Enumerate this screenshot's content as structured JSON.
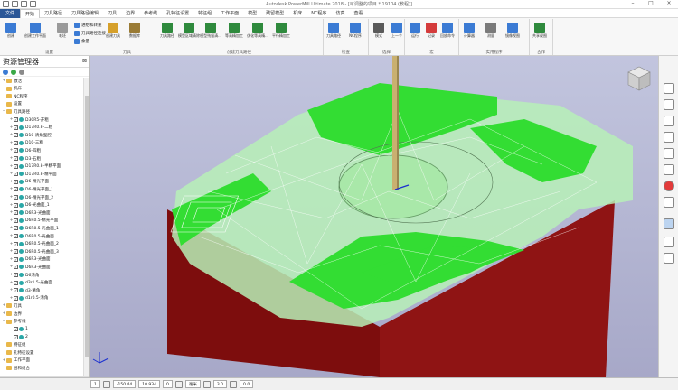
{
  "window": {
    "title": "Autodesk PowerMill Ultimate 2018 - [可调整的项目 * 19104 (教程)]"
  },
  "tabs": [
    {
      "label": "文件",
      "active": false,
      "file": true
    },
    {
      "label": "开始",
      "active": true
    },
    {
      "label": "刀具路径",
      "active": false
    },
    {
      "label": "刀具路径编辑",
      "active": false
    },
    {
      "label": "刀具",
      "active": false
    },
    {
      "label": "边界",
      "active": false
    },
    {
      "label": "参考线",
      "active": false
    },
    {
      "label": "孔特征设置",
      "active": false
    },
    {
      "label": "特征组",
      "active": false
    },
    {
      "label": "工作平面",
      "active": false
    },
    {
      "label": "模型",
      "active": false
    },
    {
      "label": "残留模型",
      "active": false
    },
    {
      "label": "机床",
      "active": false
    },
    {
      "label": "NC程序",
      "active": false
    },
    {
      "label": "仿真",
      "active": false
    },
    {
      "label": "查看",
      "active": false
    }
  ],
  "ribbon": {
    "groups": [
      {
        "label": "设置"
      },
      {
        "label": "刀具"
      },
      {
        "label": "创建刀具路径"
      },
      {
        "label": "检查"
      },
      {
        "label": "选择"
      },
      {
        "label": "宏"
      },
      {
        "label": "实用程序"
      },
      {
        "label": "合作"
      }
    ],
    "large_buttons": [
      {
        "label": "创建"
      },
      {
        "label": "创建工作平面"
      },
      {
        "label": "毛坯"
      },
      {
        "label": "创建刀具"
      },
      {
        "label": "数据库"
      },
      {
        "label": "刀具路径"
      },
      {
        "label": "模型区域清除"
      },
      {
        "label": "模型残留清..."
      },
      {
        "label": "等高精加工"
      },
      {
        "label": "优化等高精..."
      },
      {
        "label": "平行精加工"
      },
      {
        "label": "刀具路径"
      },
      {
        "label": "NC程序"
      },
      {
        "label": "模式"
      },
      {
        "label": "上一个"
      },
      {
        "label": "运行"
      },
      {
        "label": "记录"
      },
      {
        "label": "回放命令"
      },
      {
        "label": "计算器"
      },
      {
        "label": "测量"
      },
      {
        "label": "镜像视图"
      },
      {
        "label": "共享视图"
      }
    ],
    "small_buttons": [
      {
        "label": "进给和转速"
      },
      {
        "label": "刀具路径连接"
      },
      {
        "label": "余量"
      }
    ]
  },
  "explorer": {
    "title": "资源管理器",
    "tree": [
      {
        "label": "激活",
        "level": 0,
        "exp": "+"
      },
      {
        "label": "机床",
        "level": 0,
        "exp": ""
      },
      {
        "label": "NC程序",
        "level": 0,
        "exp": ""
      },
      {
        "label": "设置",
        "level": 0,
        "exp": ""
      },
      {
        "label": "刀具路径",
        "level": 0,
        "exp": "−"
      },
      {
        "label": "D30R5-开粗",
        "level": 1,
        "exp": "+"
      },
      {
        "label": "D17R0.8-二粗",
        "level": 1,
        "exp": "+"
      },
      {
        "label": "D10-清角型腔",
        "level": 1,
        "exp": "+"
      },
      {
        "label": "D10-三粗",
        "level": 1,
        "exp": "+"
      },
      {
        "label": "D6-四粗",
        "level": 1,
        "exp": "+"
      },
      {
        "label": "D3-五粗",
        "level": 1,
        "exp": "+"
      },
      {
        "label": "D17R0.8-半精平面",
        "level": 1,
        "exp": "+"
      },
      {
        "label": "D17R0.8-精平面",
        "level": 1,
        "exp": "+"
      },
      {
        "label": "D6-精光平面",
        "level": 1,
        "exp": "+"
      },
      {
        "label": "D6-精光平面_1",
        "level": 1,
        "exp": "+"
      },
      {
        "label": "D6-精光平面_2",
        "level": 1,
        "exp": "+"
      },
      {
        "label": "D6-光曲面_1",
        "level": 1,
        "exp": "+"
      },
      {
        "label": "D6R3-光曲面",
        "level": 1,
        "exp": "+"
      },
      {
        "label": "D6R0.5-精光平面",
        "level": 1,
        "exp": "+"
      },
      {
        "label": "D6R0.5-光曲面_1",
        "level": 1,
        "exp": "+"
      },
      {
        "label": "D6R0.5-光曲面",
        "level": 1,
        "exp": "+"
      },
      {
        "label": "D6R0.5-光曲面_2",
        "level": 1,
        "exp": "+"
      },
      {
        "label": "D6R0.5-光曲面_3",
        "level": 1,
        "exp": "+"
      },
      {
        "label": "D6R3-光曲面",
        "level": 1,
        "exp": "+"
      },
      {
        "label": "D6R3-光曲面",
        "level": 1,
        "exp": "+"
      },
      {
        "label": "D6清角",
        "level": 1,
        "exp": "+"
      },
      {
        "label": "d3r1.5-光曲面",
        "level": 1,
        "exp": "+"
      },
      {
        "label": "d3-清角",
        "level": 1,
        "exp": "+"
      },
      {
        "label": "d1r0.5-清角",
        "level": 1,
        "exp": "+"
      },
      {
        "label": "刀具",
        "level": 0,
        "exp": "+"
      },
      {
        "label": "边界",
        "level": 0,
        "exp": "+"
      },
      {
        "label": "参考线",
        "level": 0,
        "exp": "−"
      },
      {
        "label": "1",
        "level": 1,
        "exp": ""
      },
      {
        "label": "2",
        "level": 1,
        "exp": ""
      },
      {
        "label": "特征组",
        "level": 0,
        "exp": ""
      },
      {
        "label": "孔特征设置",
        "level": 0,
        "exp": ""
      },
      {
        "label": "工作平面",
        "level": 0,
        "exp": "+"
      },
      {
        "label": "层和组合",
        "level": 0,
        "exp": ""
      }
    ]
  },
  "status": {
    "num_field": "1",
    "x": "-150.44",
    "y": "10.934",
    "z": "0",
    "units": "毫米",
    "step": "3.0",
    "tol": "0.0"
  }
}
